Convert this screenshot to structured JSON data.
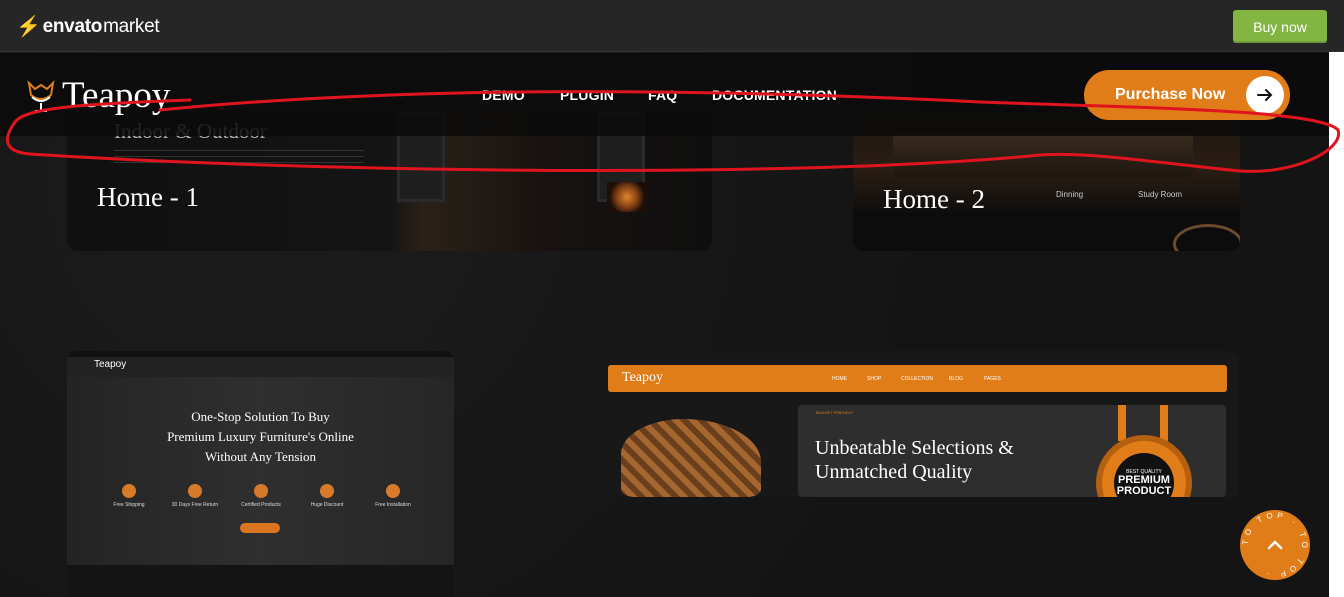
{
  "topbar": {
    "brand_leaf": "envato",
    "brand_suffix": "market",
    "buy_now": "Buy now",
    "accent": "#82b541"
  },
  "header": {
    "logo_text": "Teapoy",
    "nav": [
      "DEMO",
      "PLUGIN",
      "FAQ",
      "DOCUMENTATION"
    ],
    "purchase_label": "Purchase Now",
    "accent": "#e07d18"
  },
  "cards": {
    "home1": {
      "subtitle": "Indoor & Outdoor",
      "label": "Home - 1"
    },
    "home2": {
      "label": "Home - 2",
      "rooms": [
        "Dinning",
        "Study Room"
      ]
    },
    "home3": {
      "logo": "Teapoy",
      "lines": [
        "One-Stop Solution   To Buy",
        "Premium Luxury   Furniture's Online",
        "Without Any Tension"
      ],
      "features": [
        "Free Shipping",
        "30 Days Free Return",
        "Certified Products",
        "Huge Discount",
        "Free Installation"
      ]
    },
    "home4": {
      "logo": "Teapoy",
      "menu": [
        "HOME",
        "SHOP",
        "COLLECTION",
        "BLOG",
        "PAGES"
      ],
      "tag": "BUDGET FRIENDLY",
      "headline_1": "Unbeatable Selections &",
      "headline_2": "Unmatched Quality",
      "badge_top": "BEST QUALITY",
      "badge_main": "PREMIUM PRODUCT"
    }
  },
  "to_top": {
    "ring_text": "TO TOP · TO TOP ·",
    "icon": "chevron-up-icon"
  },
  "annotation": {
    "color": "#e0141e"
  }
}
